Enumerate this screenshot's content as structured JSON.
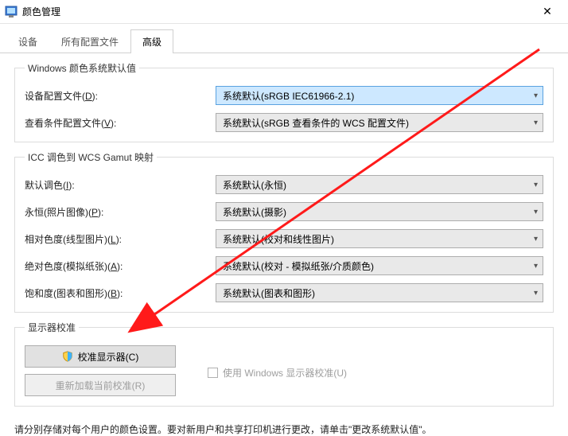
{
  "window": {
    "title": "颜色管理",
    "close": "✕"
  },
  "tabs": {
    "devices": "设备",
    "all_profiles": "所有配置文件",
    "advanced": "高级"
  },
  "section_defaults": {
    "legend": "Windows 颜色系统默认值",
    "device_profile_label": "设备配置文件(",
    "device_profile_key": "D",
    "device_profile_suffix": "):",
    "device_profile_value": "系统默认(sRGB IEC61966-2.1)",
    "viewing_label": "查看条件配置文件(",
    "viewing_key": "V",
    "viewing_suffix": "):",
    "viewing_value": "系统默认(sRGB 查看条件的 WCS 配置文件)"
  },
  "section_icc": {
    "legend": "ICC 调色到 WCS Gamut 映射",
    "default_intent_label": "默认调色(",
    "default_intent_key": "I",
    "default_intent_suffix": "):",
    "default_intent_value": "系统默认(永恒)",
    "perceptual_label": "永恒(照片图像)(",
    "perceptual_key": "P",
    "perceptual_suffix": "):",
    "perceptual_value": "系统默认(摄影)",
    "relative_label": "相对色度(线型图片)(",
    "relative_key": "L",
    "relative_suffix": "):",
    "relative_value": "系统默认(校对和线性图片)",
    "absolute_label": "绝对色度(模拟纸张)(",
    "absolute_key": "A",
    "absolute_suffix": "):",
    "absolute_value": "系统默认(校对 - 模拟纸张/介质颜色)",
    "saturation_label": "饱和度(图表和图形)(",
    "saturation_key": "B",
    "saturation_suffix": "):",
    "saturation_value": "系统默认(图表和图形)"
  },
  "section_calib": {
    "legend": "显示器校准",
    "btn_calibrate_pre": "校准显示器(",
    "btn_calibrate_key": "C",
    "btn_calibrate_suf": ")",
    "btn_reload_pre": "重新加载当前校准(",
    "btn_reload_key": "R",
    "btn_reload_suf": ")",
    "chk_pre": "使用 Windows 显示器校准(",
    "chk_key": "U",
    "chk_suf": ")"
  },
  "footer": "请分别存储对每个用户的颜色设置。要对新用户和共享打印机进行更改，请单击\"更改系统默认值\"。"
}
